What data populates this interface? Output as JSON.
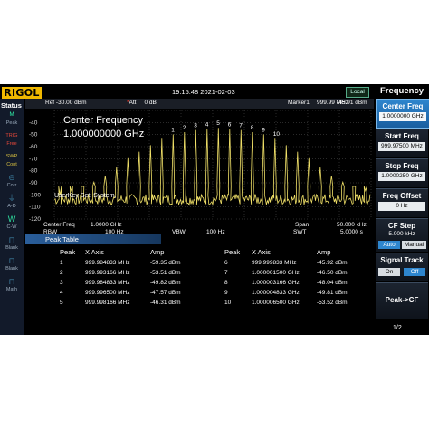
{
  "header": {
    "logo": "RIGOL",
    "datetime": "19:15:48 2021-02-03",
    "local_badge": "Local",
    "menu_title": "Frequency"
  },
  "status_panel": {
    "title": "Status",
    "items": [
      {
        "glyph": "ᴹ",
        "label": "Peak",
        "style": "on"
      },
      {
        "glyph": "TRIG",
        "label": "Free",
        "style": "red"
      },
      {
        "glyph": "SWP",
        "label": "Cont",
        "style": "red2"
      },
      {
        "glyph": "⊖",
        "label": "Corr",
        "style": "dim"
      },
      {
        "glyph": "⏚",
        "label": "A-D",
        "style": "dim"
      },
      {
        "glyph": "W",
        "label": "C-W",
        "style": "on"
      },
      {
        "glyph": "⊓",
        "label": "Blank",
        "style": "dim"
      },
      {
        "glyph": "⊓",
        "label": "Blank",
        "style": "dim"
      },
      {
        "glyph": "⊓",
        "label": "Math",
        "style": "dim"
      }
    ]
  },
  "info_bar": {
    "ref_level": "Ref -30.00 dBm",
    "att_prefix": "*",
    "att_label": "Att",
    "att_value": "0 dB",
    "marker_label": "Marker1",
    "marker_freq": "999.99 MHz",
    "marker_amp": "-45.91 dBm"
  },
  "plot": {
    "center_label": "Center Frequency",
    "center_value": "1.000000000 GHz",
    "userkey_text": "UserKey Set:  System,",
    "y_labels": [
      "-40",
      "-50",
      "-60",
      "-70",
      "-80",
      "-90",
      "-100",
      "-110",
      "-120"
    ],
    "marker_numbers": [
      "1",
      "2",
      "3",
      "4",
      "5",
      "6",
      "7",
      "8",
      "9",
      "10"
    ],
    "colors": {
      "trace": "#f0e068",
      "grid": "#555555",
      "background": "#000000"
    }
  },
  "freq_rows": {
    "center_label": "Center Freq",
    "center_value": "1.0000 GHz",
    "span_label": "Span",
    "span_value": "50.000 kHz",
    "rbw_label": "RBW",
    "rbw_value": "100 Hz",
    "vbw_label": "VBW",
    "vbw_value": "100 Hz",
    "swt_label": "SWT",
    "swt_value": "5.0000 s"
  },
  "peak_table": {
    "title": "Peak Table",
    "columns": [
      "Peak",
      "X Axis",
      "Amp"
    ],
    "left": [
      {
        "peak": "1",
        "x": "999.984833 MHz",
        "amp": "-59.35 dBm"
      },
      {
        "peak": "2",
        "x": "999.993166 MHz",
        "amp": "-53.51 dBm"
      },
      {
        "peak": "3",
        "x": "999.984833 MHz",
        "amp": "-49.82 dBm"
      },
      {
        "peak": "4",
        "x": "999.996500 MHz",
        "amp": "-47.57 dBm"
      },
      {
        "peak": "5",
        "x": "999.998166 MHz",
        "amp": "-46.31 dBm"
      }
    ],
    "right": [
      {
        "peak": "6",
        "x": "999.999833 MHz",
        "amp": "-45.92 dBm"
      },
      {
        "peak": "7",
        "x": "1.000001500 GHz",
        "amp": "-46.50 dBm"
      },
      {
        "peak": "8",
        "x": "1.000003166 GHz",
        "amp": "-48.04 dBm"
      },
      {
        "peak": "9",
        "x": "1.000004833 GHz",
        "amp": "-49.81 dBm"
      },
      {
        "peak": "10",
        "x": "1.000006500 GHz",
        "amp": "-53.52 dBm"
      }
    ]
  },
  "softkeys": {
    "center_freq": {
      "label": "Center Freq",
      "value": "1.0000000 GHz"
    },
    "start_freq": {
      "label": "Start Freq",
      "value": "999.97500 MHz"
    },
    "stop_freq": {
      "label": "Stop Freq",
      "value": "1.0000250 GHz"
    },
    "freq_offset": {
      "label": "Freq Offset",
      "value": "0 Hz"
    },
    "cf_step": {
      "label": "CF Step",
      "value": "5.000 kHz",
      "opt_auto": "Auto",
      "opt_manual": "Manual"
    },
    "signal_track": {
      "label": "Signal Track",
      "opt_on": "On",
      "opt_off": "Off"
    },
    "peak_cf": {
      "label": "Peak->CF"
    },
    "page": "1/2"
  }
}
